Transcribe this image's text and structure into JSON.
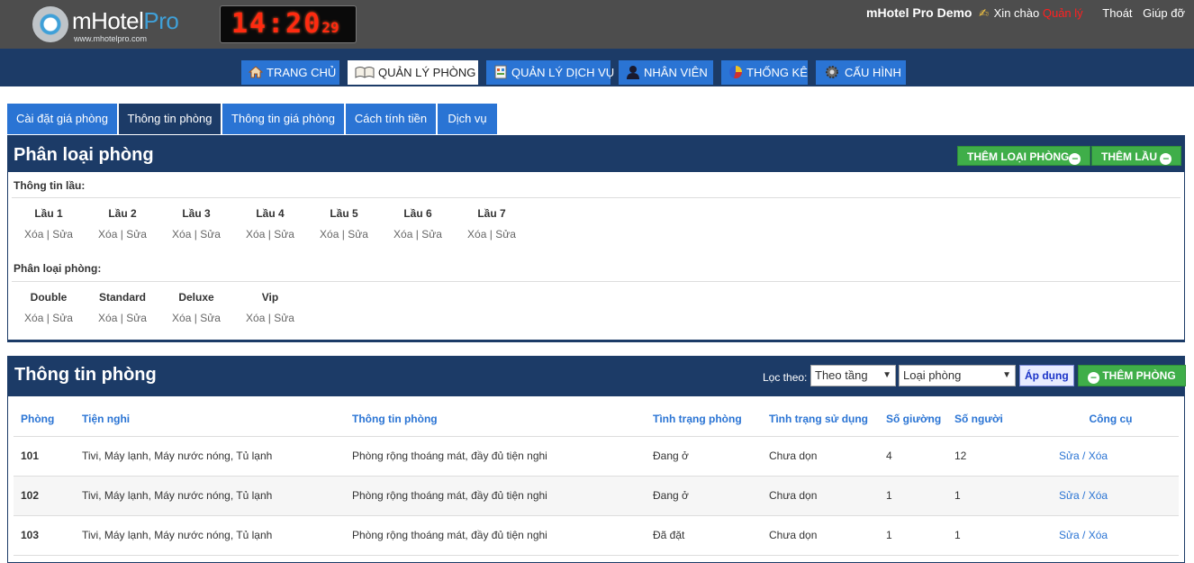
{
  "header": {
    "logo_main": "mHotel",
    "logo_pro": "Pro",
    "logo_url": "www.mhotelpro.com",
    "clock_hm": "14:20",
    "clock_s": "29",
    "brand": "mHotel Pro Demo",
    "greeting": "Xin chào",
    "username": "Quản lý",
    "logout": "Thoát",
    "help": "Giúp đỡ"
  },
  "nav": [
    {
      "label": "Trang chủ",
      "icon": "home-icon"
    },
    {
      "label": "Quản lý phòng",
      "icon": "book-icon"
    },
    {
      "label": "Quản lý dịch vụ",
      "icon": "service-icon"
    },
    {
      "label": "Nhân viên",
      "icon": "user-icon"
    },
    {
      "label": "Thống kê",
      "icon": "pie-chart-icon"
    },
    {
      "label": "Cấu hình",
      "icon": "gear-icon"
    }
  ],
  "subtabs": [
    "Cài đặt giá phòng",
    "Thông tin phòng",
    "Thông tin giá phòng",
    "Cách tính tiền",
    "Dịch vụ"
  ],
  "room_types_panel": {
    "title": "Phân loại phòng",
    "add_type_button": "Thêm loại phòng",
    "add_floor_button": "Thêm lầu",
    "floor_section_label": "Thông tin lầu:",
    "floors": [
      "Lầu 1",
      "Lầu 2",
      "Lầu 3",
      "Lầu 4",
      "Lầu 5",
      "Lầu 6",
      "Lầu 7"
    ],
    "type_section_label": "Phân loại phòng:",
    "types": [
      "Double",
      "Standard",
      "Deluxe",
      "Vip"
    ],
    "delete_label": "Xóa",
    "separator": "|",
    "edit_label": "Sửa"
  },
  "rooms_panel": {
    "title": "Thông tin phòng",
    "filter_label": "Lọc theo:",
    "floor_select": "Theo tầng",
    "type_select": "Loại phòng",
    "apply_button": "Áp dụng",
    "add_room_button": "Thêm phòng",
    "columns": [
      "Phòng",
      "Tiện nghi",
      "Thông tin phòng",
      "Tình trạng phòng",
      "Tình trạng sử dụng",
      "Số giường",
      "Số người",
      "Công cụ"
    ],
    "rows": [
      {
        "room": "101",
        "amenities": "Tivi, Máy lạnh, Máy nước nóng, Tủ lạnh",
        "info": "Phòng rộng thoáng mát, đầy đủ tiện nghi",
        "status": "Đang ở",
        "usage": "Chưa dọn",
        "beds": "4",
        "people": "12",
        "tools": "Sửa / Xóa"
      },
      {
        "room": "102",
        "amenities": "Tivi, Máy lạnh, Máy nước nóng, Tủ lạnh",
        "info": "Phòng rộng thoáng mát, đầy đủ tiện nghi",
        "status": "Đang ở",
        "usage": "Chưa dọn",
        "beds": "1",
        "people": "1",
        "tools": "Sửa / Xóa"
      },
      {
        "room": "103",
        "amenities": "Tivi, Máy lạnh, Máy nước nóng, Tủ lạnh",
        "info": "Phòng rộng thoáng mát, đầy đủ tiện nghi",
        "status": "Đã đặt",
        "usage": "Chưa dọn",
        "beds": "1",
        "people": "1",
        "tools": "Sửa / Xóa"
      }
    ]
  }
}
